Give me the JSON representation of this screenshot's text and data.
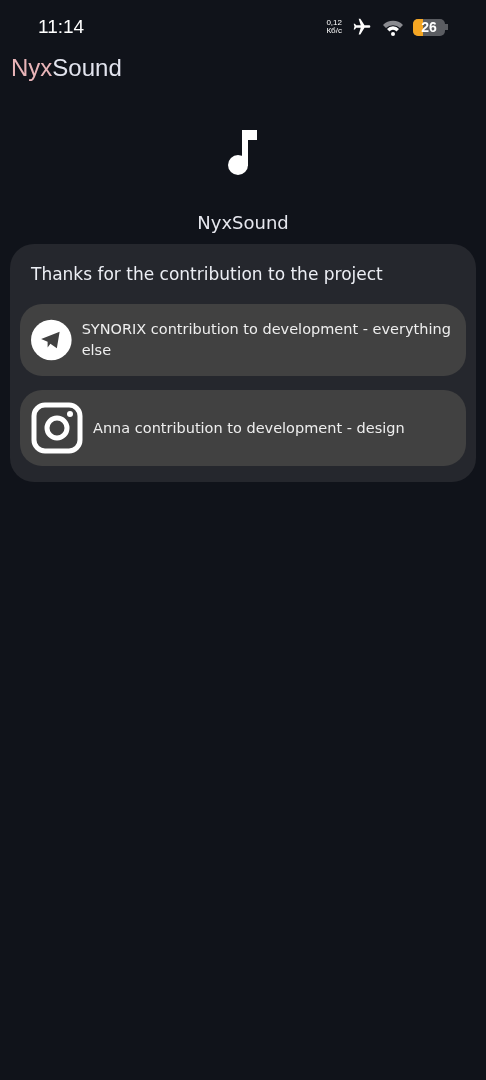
{
  "status_bar": {
    "time": "11:14",
    "net_speed": "0,12",
    "net_unit": "Кб/с",
    "battery": "26"
  },
  "app_logo": {
    "parts": [
      {
        "text": "Nyx",
        "color": "#e8b4b8"
      },
      {
        "text": "Sound",
        "color": "#e2e4ee"
      }
    ]
  },
  "app_name": "NyxSound",
  "credits": {
    "title": "Thanks for the contribution to the project",
    "items": [
      {
        "kind": "telegram",
        "text": "SYNORIX contribution to development - everything else"
      },
      {
        "kind": "instagram",
        "text": "Anna contribution to development - design"
      }
    ]
  }
}
